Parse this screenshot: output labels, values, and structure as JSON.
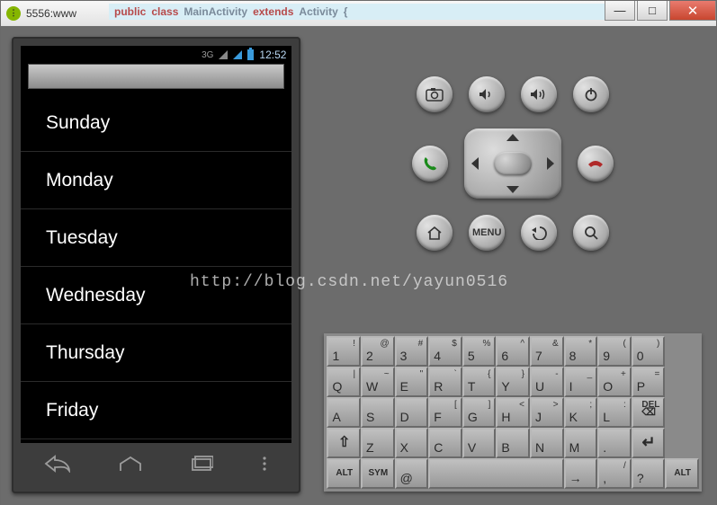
{
  "window": {
    "title": "5556:www"
  },
  "bgcode": {
    "w1": "public",
    "w2": "class",
    "w3": "MainActivity",
    "w4": "extends",
    "w5": "Activity",
    "w6": "{"
  },
  "statusbar": {
    "sig": "3G",
    "time": "12:52"
  },
  "list": {
    "items": [
      "Sunday",
      "Monday",
      "Tuesday",
      "Wednesday",
      "Thursday",
      "Friday"
    ]
  },
  "hw": {
    "menu": "MENU"
  },
  "keyboard": {
    "row1": [
      {
        "m": "1",
        "s": "!"
      },
      {
        "m": "2",
        "s": "@"
      },
      {
        "m": "3",
        "s": "#"
      },
      {
        "m": "4",
        "s": "$"
      },
      {
        "m": "5",
        "s": "%"
      },
      {
        "m": "6",
        "s": "^"
      },
      {
        "m": "7",
        "s": "&"
      },
      {
        "m": "8",
        "s": "*"
      },
      {
        "m": "9",
        "s": "("
      },
      {
        "m": "0",
        "s": ")"
      }
    ],
    "row2": [
      {
        "m": "Q",
        "s": "|"
      },
      {
        "m": "W",
        "s": "~"
      },
      {
        "m": "E",
        "s": "\""
      },
      {
        "m": "R",
        "s": "`"
      },
      {
        "m": "T",
        "s": "{"
      },
      {
        "m": "Y",
        "s": "}"
      },
      {
        "m": "U",
        "s": "-"
      },
      {
        "m": "I",
        "s": "_"
      },
      {
        "m": "O",
        "s": "+"
      },
      {
        "m": "P",
        "s": "="
      }
    ],
    "row3": [
      {
        "m": "A",
        "s": ""
      },
      {
        "m": "S",
        "s": ""
      },
      {
        "m": "D",
        "s": ""
      },
      {
        "m": "F",
        "s": "["
      },
      {
        "m": "G",
        "s": "]"
      },
      {
        "m": "H",
        "s": "<"
      },
      {
        "m": "J",
        "s": ">"
      },
      {
        "m": "K",
        "s": ";"
      },
      {
        "m": "L",
        "s": ":"
      },
      {
        "m": "DEL",
        "s": ""
      }
    ],
    "row4": [
      {
        "m": "⇧",
        "s": ""
      },
      {
        "m": "Z",
        "s": ""
      },
      {
        "m": "X",
        "s": ""
      },
      {
        "m": "C",
        "s": ""
      },
      {
        "m": "V",
        "s": ""
      },
      {
        "m": "B",
        "s": ""
      },
      {
        "m": "N",
        "s": ""
      },
      {
        "m": "M",
        "s": ""
      },
      {
        "m": ".",
        "s": ""
      },
      {
        "m": "↵",
        "s": ""
      }
    ],
    "row5": [
      {
        "m": "ALT",
        "s": "",
        "w": 1
      },
      {
        "m": "SYM",
        "s": "",
        "w": 1
      },
      {
        "m": "@",
        "s": "",
        "w": 1
      },
      {
        "m": "",
        "s": "",
        "w": 4
      },
      {
        "m": "→",
        "s": "",
        "w": 1
      },
      {
        "m": ",",
        "s": "/",
        "w": 1
      },
      {
        "m": "?",
        "s": "",
        "w": 1
      },
      {
        "m": "ALT",
        "s": "",
        "w": 1
      }
    ]
  },
  "watermark": "http://blog.csdn.net/yayun0516"
}
